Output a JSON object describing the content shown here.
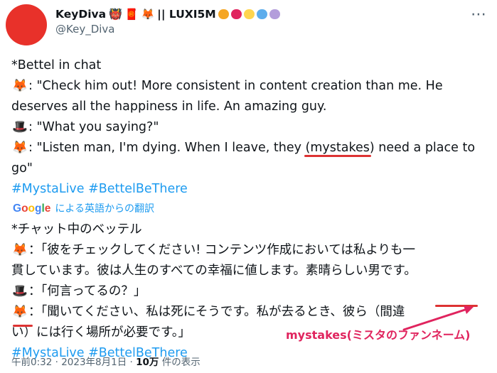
{
  "author": {
    "display_name": "KeyDiva",
    "suffix": "|| LUXI5M",
    "handle": "@Key_Diva",
    "name_emojis": [
      "👹",
      "🧧",
      "🦊"
    ],
    "heart_colors": [
      "#f5a623",
      "#e0245e",
      "#ffd54f",
      "#5dadec",
      "#b39ddb"
    ]
  },
  "more_icon": "⋯",
  "tweet": {
    "line1": "*Bettel in chat",
    "line2": ": \"Check him out! More consistent in content creation than me. He",
    "line3": "deserves all the happiness in life. An amazing guy.",
    "line4": ": \"What you saying?\"",
    "line5": ": \"Listen man, I'm dying. When I leave, they (mystakes) need a place to",
    "line6": "go\"",
    "hashtags": "#MystaLive #BettelBeThere"
  },
  "translation": {
    "provider_letters": [
      "G",
      "o",
      "o",
      "g",
      "l",
      "e"
    ],
    "label": "による英語からの翻訳"
  },
  "translated": {
    "line1": "*チャット中のベッテル",
    "line2": "：「彼をチェックしてください! コンテンツ作成においては私よりも一",
    "line3": "貫しています。彼は人生のすべての幸福に値します。素晴らしい男です。",
    "line4": "：「何言ってるの？」",
    "line5": "：「聞いてください、私は死にそうです。私が去るとき、彼ら（間違",
    "line6": "い）には行く場所が必要です。」",
    "hashtags": "#MystaLive #BettelBeThere"
  },
  "annotation": {
    "text": "mystakes(ミスタのファンネーム)"
  },
  "footer": {
    "timestamp": "午前0:32 · 2023年8月1日 · ",
    "views_count": "10万",
    "views_label": " 件の表示"
  },
  "icons": {
    "fox": "🦊",
    "tophat": "🎩"
  }
}
